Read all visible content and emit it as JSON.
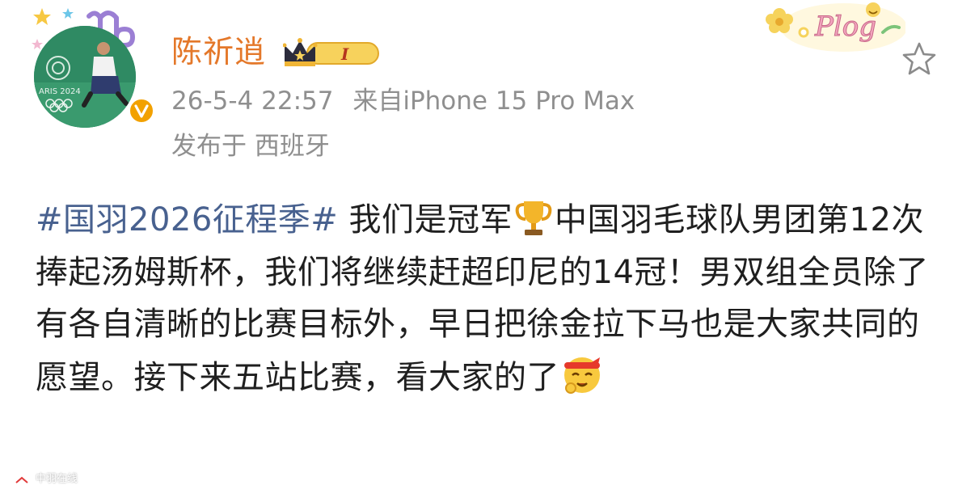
{
  "post": {
    "author": {
      "name": "陈祈逍",
      "level_badge": "I"
    },
    "avatar_text": "ARIS 2024",
    "meta": {
      "timestamp": "26-5-4 22:57",
      "source": "来自iPhone 15 Pro Max",
      "location": "发布于 西班牙"
    },
    "plog_text": "Plog",
    "content": {
      "hashtag": "#国羽2026征程季#",
      "part1": " 我们是冠军",
      "part2": "中国羽毛球队男团第12次捧起汤姆斯杯，我们将继续赶超印尼的14冠！男双组全员除了有各自清晰的比赛目标外，早日把徐金拉下马也是大家共同的愿望。接下来五站比赛，看大家的了"
    },
    "watermark": "中羽在线"
  },
  "icons": {
    "trophy": "trophy-emoji",
    "fighting_face": "fighting-face-emoji",
    "star": "star-outline-icon",
    "verified": "verified-v-icon"
  },
  "colors": {
    "username": "#e4782a",
    "meta": "#8f8f8f",
    "hashtag": "#48618f",
    "verified": "#f2a100"
  }
}
